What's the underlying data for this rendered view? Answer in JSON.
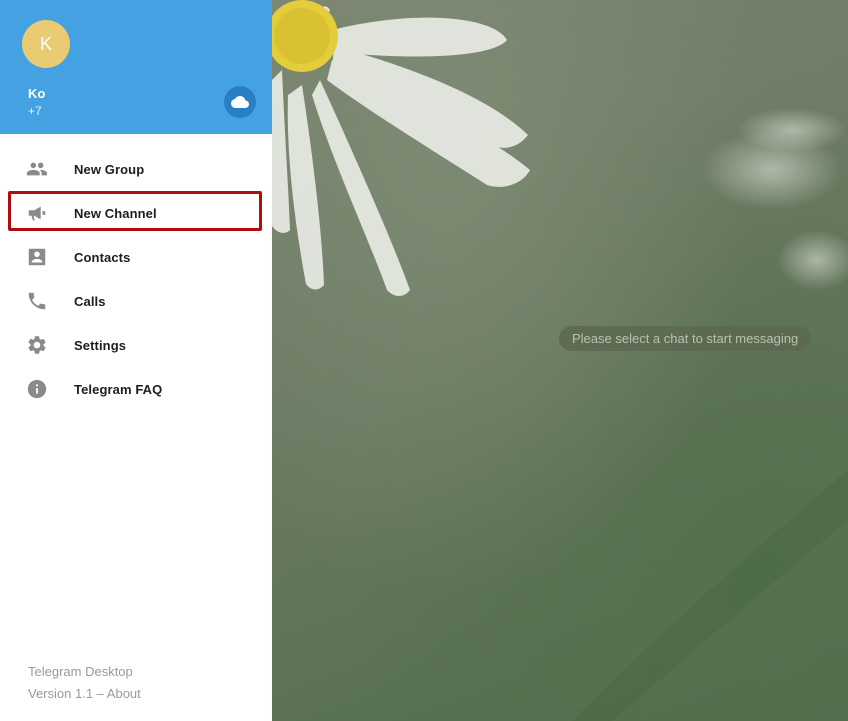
{
  "profile": {
    "avatar_initial": "K",
    "name": "Ko",
    "phone": "+7",
    "saved_icon": "cloud-icon"
  },
  "menu": {
    "items": [
      {
        "label": "New Group",
        "icon": "group-icon"
      },
      {
        "label": "New Channel",
        "icon": "megaphone-icon"
      },
      {
        "label": "Contacts",
        "icon": "contact-card-icon"
      },
      {
        "label": "Calls",
        "icon": "phone-icon"
      },
      {
        "label": "Settings",
        "icon": "gear-icon"
      },
      {
        "label": "Telegram FAQ",
        "icon": "info-icon"
      }
    ],
    "highlighted_item": "New Channel"
  },
  "footer": {
    "app_name": "Telegram Desktop",
    "version": "Version 1.1 –",
    "about_link": "About"
  },
  "chat": {
    "empty_hint": "Please select a chat to start messaging"
  },
  "colors": {
    "header_bg": "#44a2e2",
    "avatar_bg": "#ebcb72",
    "highlight_border": "#b10d10",
    "icon_gray": "#8a8a8a"
  }
}
